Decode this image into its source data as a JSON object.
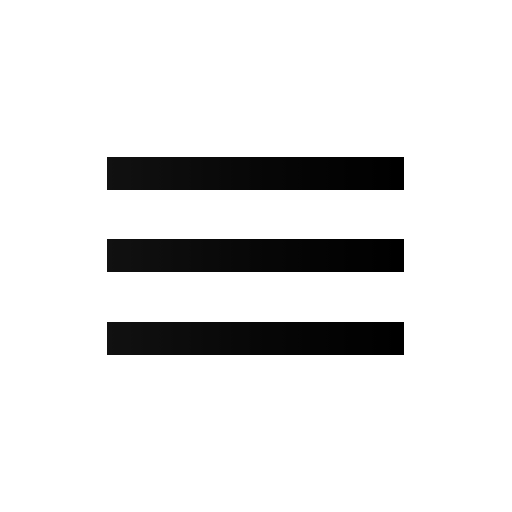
{
  "icon": {
    "name": "hamburger-menu-icon",
    "bar_count": 3,
    "color": "#0a0a0a"
  },
  "background": "#ffffff"
}
